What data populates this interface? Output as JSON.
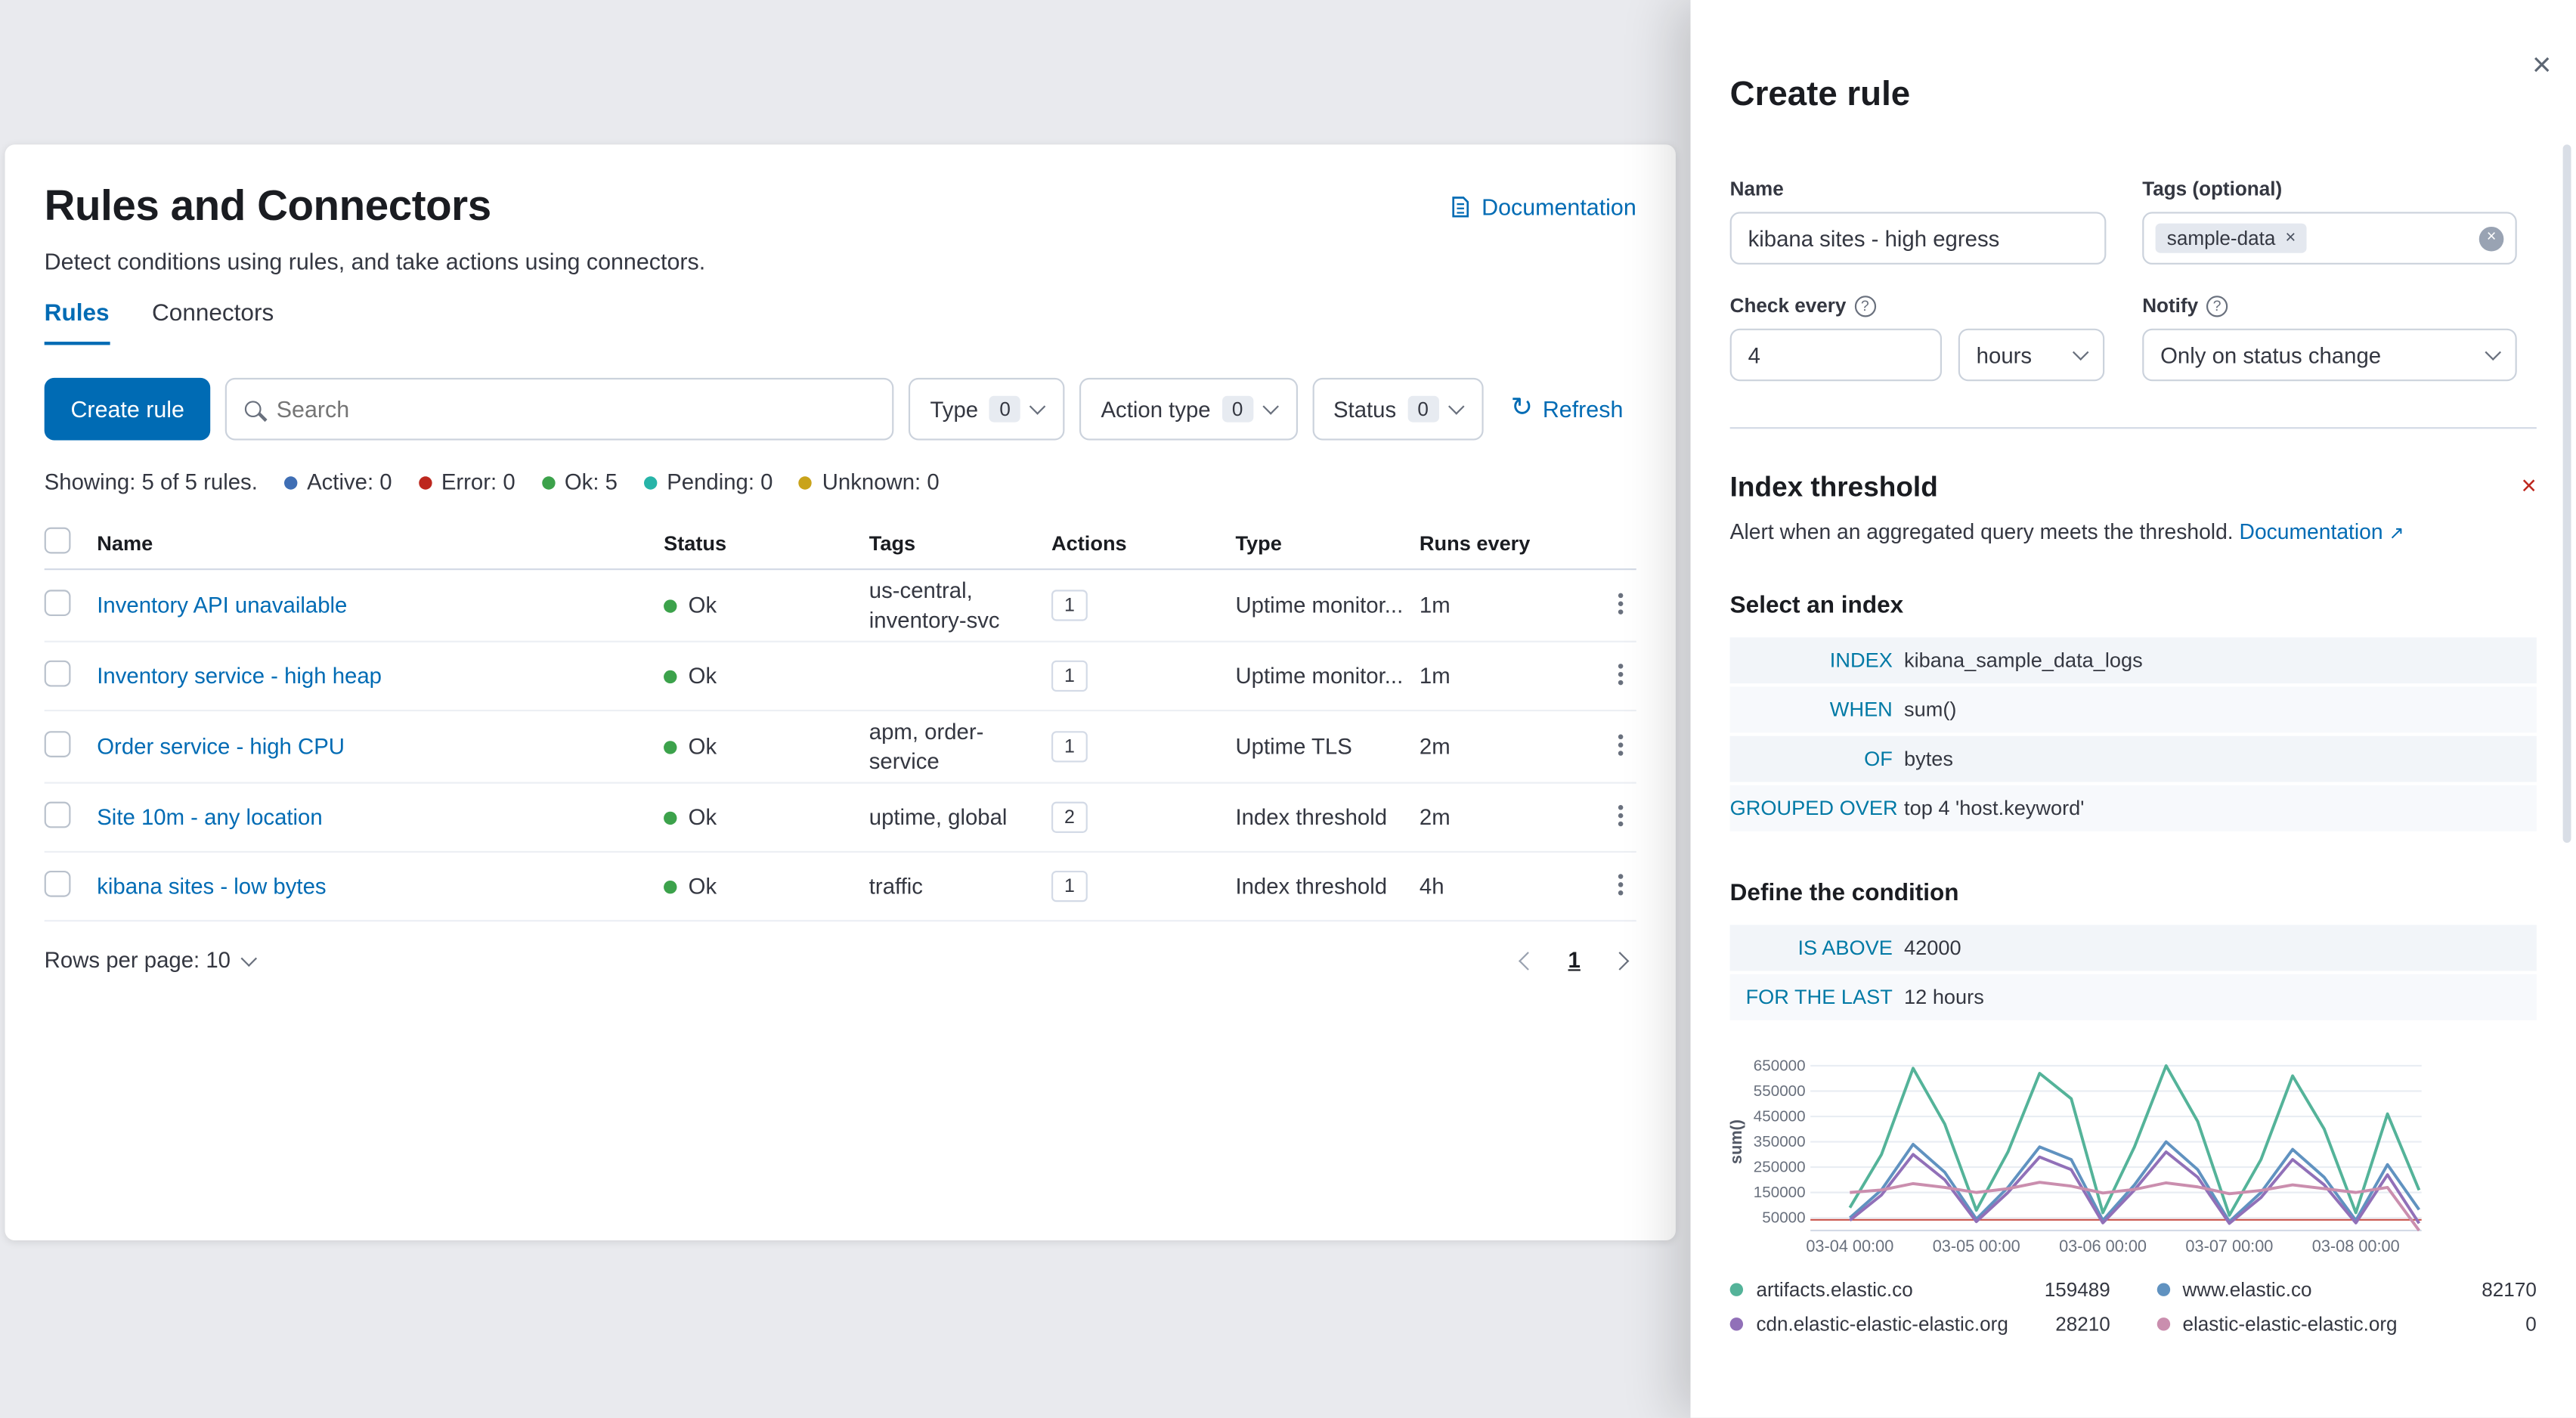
{
  "colors": {
    "primary": "#006BB4",
    "danger": "#BD271E",
    "expression_keyword": "#0079A5",
    "page_background": "#e9eaee",
    "status_ok": "#3CA24B"
  },
  "main": {
    "title": "Rules and Connectors",
    "documentation_link": "Documentation",
    "subtitle": "Detect conditions using rules, and take actions using connectors.",
    "tabs": [
      {
        "label": "Rules",
        "active": true
      },
      {
        "label": "Connectors",
        "active": false
      }
    ],
    "create_rule_button": "Create rule",
    "search_placeholder": "Search",
    "filters": [
      {
        "label": "Type",
        "count": "0"
      },
      {
        "label": "Action type",
        "count": "0"
      },
      {
        "label": "Status",
        "count": "0"
      }
    ],
    "refresh_label": "Refresh",
    "showing_text": "Showing: 5 of 5 rules.",
    "stats": [
      {
        "label": "Active: 0",
        "color": "#3F6EB4"
      },
      {
        "label": "Error: 0",
        "color": "#BD271E"
      },
      {
        "label": "Ok: 5",
        "color": "#3CA24B"
      },
      {
        "label": "Pending: 0",
        "color": "#27B4A8"
      },
      {
        "label": "Unknown: 0",
        "color": "#C9A31A"
      }
    ],
    "table": {
      "columns": [
        "Name",
        "Status",
        "Tags",
        "Actions",
        "Type",
        "Runs every"
      ],
      "status_ok_color": "#3CA24B",
      "rows": [
        {
          "name": "Inventory API unavailable",
          "status": "Ok",
          "tags": "us-central, inventory-svc",
          "actions": "1",
          "type": "Uptime monitor...",
          "runs_every": "1m"
        },
        {
          "name": "Inventory service - high heap",
          "status": "Ok",
          "tags": "",
          "actions": "1",
          "type": "Uptime monitor...",
          "runs_every": "1m"
        },
        {
          "name": "Order service - high CPU",
          "status": "Ok",
          "tags": "apm, order-service",
          "actions": "1",
          "type": "Uptime TLS",
          "runs_every": "2m"
        },
        {
          "name": "Site 10m - any location",
          "status": "Ok",
          "tags": "uptime, global",
          "actions": "2",
          "type": "Index threshold",
          "runs_every": "2m"
        },
        {
          "name": "kibana sites - low bytes",
          "status": "Ok",
          "tags": "traffic",
          "actions": "1",
          "type": "Index threshold",
          "runs_every": "4h"
        }
      ]
    },
    "rows_per_page_label": "Rows per page: 10",
    "page_number": "1"
  },
  "flyout": {
    "title": "Create rule",
    "fields": {
      "name_label": "Name",
      "name_value": "kibana sites - high egress",
      "tags_label": "Tags (optional)",
      "tag_badge": "sample-data",
      "check_every_label": "Check every",
      "check_every_value": "4",
      "check_every_unit": "hours",
      "notify_label": "Notify",
      "notify_value": "Only on status change"
    },
    "rule_type": {
      "name": "Index threshold",
      "description": "Alert when an aggregated query meets the threshold.",
      "documentation_link": "Documentation"
    },
    "select_index_heading": "Select an index",
    "expressions": [
      {
        "keyword": "INDEX",
        "value": "kibana_sample_data_logs"
      },
      {
        "keyword": "WHEN",
        "value": "sum()"
      },
      {
        "keyword": "OF",
        "value": "bytes"
      },
      {
        "keyword": "GROUPED OVER",
        "value": "top 4 'host.keyword'"
      }
    ],
    "condition_heading": "Define the condition",
    "conditions": [
      {
        "keyword": "IS ABOVE",
        "value": "42000"
      },
      {
        "keyword": "FOR THE LAST",
        "value": "12 hours"
      }
    ]
  },
  "chart_data": {
    "type": "line",
    "title": "",
    "xlabel": "",
    "ylabel": "sum()",
    "ylim": [
      0,
      700000
    ],
    "yticks": [
      650000,
      550000,
      450000,
      350000,
      250000,
      150000,
      50000
    ],
    "x_hours": [
      0,
      6,
      12,
      18,
      24,
      30,
      36,
      42,
      48,
      54,
      60,
      66,
      72,
      78,
      84,
      90,
      96,
      102,
      108
    ],
    "xticklabels": [
      "03-04 00:00",
      "03-05 00:00",
      "03-06 00:00",
      "03-07 00:00",
      "03-08 00:00"
    ],
    "threshold": 42000,
    "grid": true,
    "legend_position": "bottom",
    "series": [
      {
        "name": "artifacts.elastic.co",
        "color": "#54B399",
        "current": 159489,
        "values": [
          90000,
          300000,
          640000,
          420000,
          80000,
          310000,
          620000,
          520000,
          70000,
          330000,
          650000,
          430000,
          60000,
          280000,
          610000,
          400000,
          70000,
          460000,
          159489
        ]
      },
      {
        "name": "www.elastic.co",
        "color": "#6092C0",
        "current": 82170,
        "values": [
          50000,
          160000,
          340000,
          230000,
          45000,
          170000,
          330000,
          280000,
          40000,
          180000,
          350000,
          240000,
          35000,
          150000,
          320000,
          210000,
          40000,
          260000,
          82170
        ]
      },
      {
        "name": "cdn.elastic-elastic-elastic.org",
        "color": "#9170B8",
        "current": 28210,
        "values": [
          40000,
          140000,
          300000,
          200000,
          35000,
          150000,
          290000,
          240000,
          30000,
          160000,
          310000,
          210000,
          28000,
          130000,
          280000,
          180000,
          30000,
          220000,
          28210
        ]
      },
      {
        "name": "elastic-elastic-elastic.org",
        "color": "#CA8EAE",
        "current": 0,
        "values": [
          150000,
          160000,
          185000,
          170000,
          150000,
          165000,
          190000,
          175000,
          148000,
          162000,
          188000,
          172000,
          145000,
          158000,
          180000,
          165000,
          150000,
          170000,
          0
        ]
      }
    ]
  }
}
